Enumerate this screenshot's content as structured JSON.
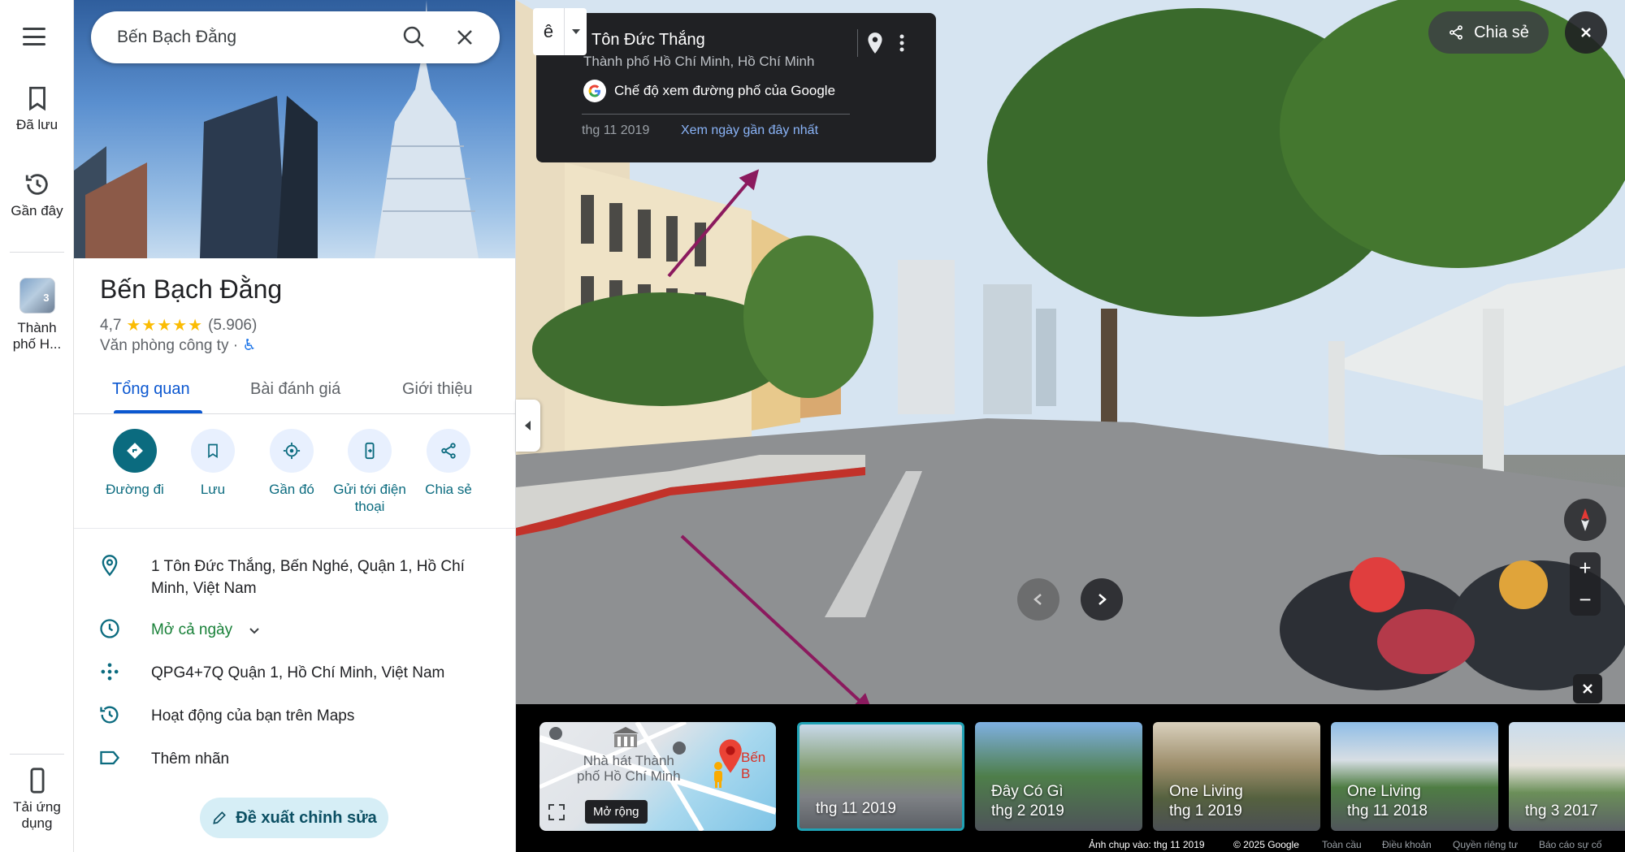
{
  "rail": {
    "saved_label": "Đã lưu",
    "recent_label": "Gần đây",
    "recent_place_label": "Thành phố H...",
    "recent_place_count": "3",
    "get_app_label": "Tải ứng dụng"
  },
  "search": {
    "value": "Bến Bạch Đằng"
  },
  "place": {
    "title": "Bến Bạch Đằng",
    "rating": "4,7",
    "stars": "★★★★★",
    "review_count": "(5.906)",
    "category": "Văn phòng công ty ·",
    "accessibility_icon": "wheelchair-icon"
  },
  "tabs": {
    "overview": "Tổng quan",
    "reviews": "Bài đánh giá",
    "about": "Giới thiệu"
  },
  "actions": {
    "directions": "Đường đi",
    "save": "Lưu",
    "nearby": "Gần đó",
    "send_to_phone": "Gửi tới điện thoại",
    "share": "Chia sẻ"
  },
  "info": {
    "address": "1 Tôn Đức Thắng, Bến Nghé, Quận 1, Hồ Chí Minh, Việt Nam",
    "hours": "Mở cả ngày",
    "plus_code": "QPG4+7Q Quận 1, Hồ Chí Minh, Việt Nam",
    "activity": "Hoạt động của bạn trên Maps",
    "label": "Thêm nhãn"
  },
  "suggest_edit": "Đề xuất chỉnh sửa",
  "streetview": {
    "nav_glyph": "ê",
    "street_name": "Tôn Đức Thắng",
    "city": "Thành phố Hồ Chí Minh, Hồ Chí Minh",
    "provider": "Chế độ xem đường phố của Google",
    "date": "thg 11 2019",
    "latest_link": "Xem ngày gần đây nhất",
    "share_label": "Chia sẻ"
  },
  "minimap": {
    "landmark": "Nhà hát Thành phố Hồ Chí Minh",
    "landmark_line1": "Nhà hát Thành",
    "landmark_line2": "phố Hồ Chí Minh",
    "edge_label": "Bến B",
    "expand_label": "Mở rộng"
  },
  "thumbnails": [
    {
      "title": "",
      "date": "thg 11 2019"
    },
    {
      "title": "Đây Có Gì",
      "date": "thg 2 2019"
    },
    {
      "title": "One Living",
      "date": "thg 1 2019"
    },
    {
      "title": "One Living",
      "date": "thg 11 2018"
    },
    {
      "title": "",
      "date": "thg 3 2017"
    }
  ],
  "footer": {
    "captured": "Ảnh chụp vào: thg 11 2019",
    "copyright": "© 2025 Google",
    "global": "Toàn cầu",
    "terms": "Điều khoản",
    "privacy": "Quyền riêng tư",
    "report": "Báo cáo sự cố"
  },
  "colors": {
    "accent": "#0b57d0",
    "teal": "#0b6b7f",
    "open_green": "#188038",
    "arrow_annotation": "#8b1a5e"
  }
}
